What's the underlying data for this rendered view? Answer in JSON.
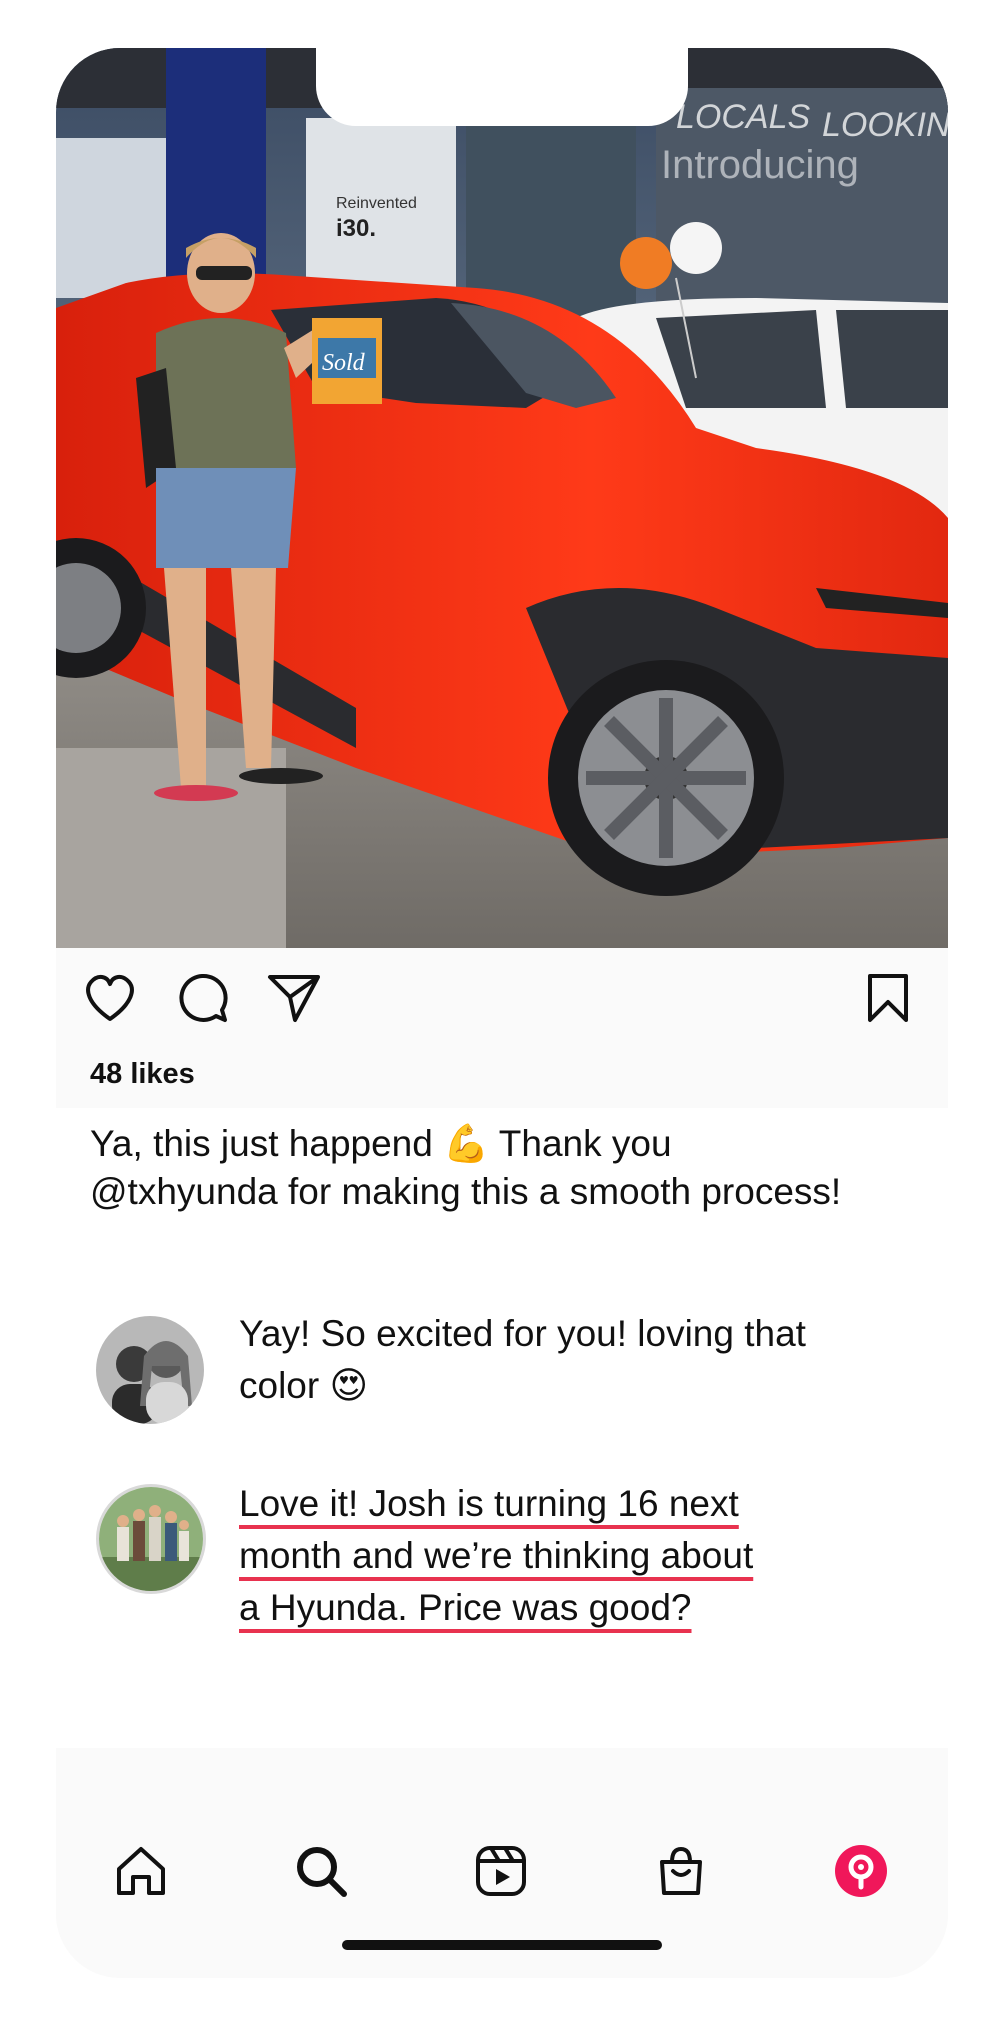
{
  "post": {
    "likes": "48 likes",
    "caption": "Ya, this just happend 💪 Thank you @txhyunda for making this a smooth process!",
    "photo_sign_text": "Sold",
    "photo_window_text_1": "LOCALS",
    "photo_window_text_2": "LOOKING",
    "photo_window_text_3": "Introducing",
    "photo_window_text_4": "Reinvented",
    "photo_window_text_5": "i30."
  },
  "comments": [
    {
      "text": "Yay! So excited for you! loving that color 😍"
    },
    {
      "lines": [
        "Love it! Josh is turning 16 next",
        "month and we’re thinking about",
        "a Hyunda. Price was good?"
      ]
    }
  ],
  "icons": {
    "like": "heart-icon",
    "comment": "comment-icon",
    "share": "send-icon",
    "save": "bookmark-icon",
    "nav": [
      "home-icon",
      "search-icon",
      "reels-icon",
      "shop-icon",
      "profile-icon"
    ]
  },
  "colors": {
    "accent": "#f0175a",
    "underline": "#e8324f"
  }
}
